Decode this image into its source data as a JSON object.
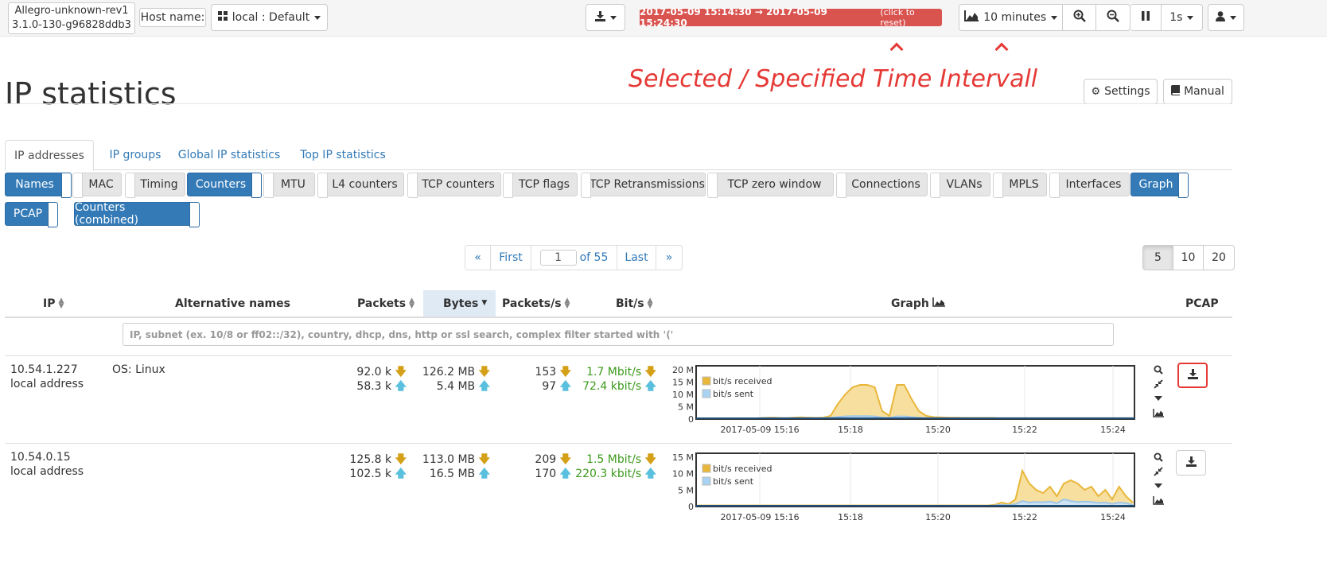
{
  "topbar": {
    "device_line1": "Allegro-unknown-rev1",
    "device_line2": "3.1.0-130-g96828ddb3",
    "host_label": "Host name:",
    "host_value": "local : Default",
    "time_range": "2017-05-09 15:14:30 → 2017-05-09 15:24:30",
    "time_range_hint": "(click to reset)",
    "interval": "10 minutes",
    "refresh_rate": "1s"
  },
  "annotation": "Selected / Specified Time Intervall",
  "page": {
    "title": "IP statistics",
    "settings_label": "Settings",
    "manual_label": "Manual"
  },
  "tabs": [
    "IP addresses",
    "IP groups",
    "Global IP statistics",
    "Top IP statistics"
  ],
  "toggles": [
    {
      "label": "Names",
      "on": true
    },
    {
      "label": "MAC",
      "on": false
    },
    {
      "label": "Timing",
      "on": false
    },
    {
      "label": "Counters",
      "on": true
    },
    {
      "label": "MTU",
      "on": false
    },
    {
      "label": "L4 counters",
      "on": false
    },
    {
      "label": "TCP counters",
      "on": false
    },
    {
      "label": "TCP flags",
      "on": false
    },
    {
      "label": "TCP Retransmissions",
      "on": false
    },
    {
      "label": "TCP zero window",
      "on": false
    },
    {
      "label": "Connections",
      "on": false
    },
    {
      "label": "VLANs",
      "on": false
    },
    {
      "label": "MPLS",
      "on": false
    },
    {
      "label": "Interfaces",
      "on": false
    },
    {
      "label": "Graph",
      "on": true
    },
    {
      "label": "PCAP",
      "on": true
    },
    {
      "label": "Counters (combined)",
      "on": true
    }
  ],
  "pagination": {
    "prev": "«",
    "first": "First",
    "current": "1",
    "of": "of 55",
    "last": "Last",
    "next": "»",
    "sizes": [
      "5",
      "10",
      "20"
    ],
    "selected_size": "5"
  },
  "columns": {
    "ip": "IP",
    "alt": "Alternative names",
    "packets": "Packets",
    "bytes": "Bytes",
    "pps": "Packets/s",
    "bps": "Bit/s",
    "graph": "Graph",
    "pcap": "PCAP"
  },
  "filter_placeholder": "IP, subnet (ex. 10/8 or ff02::/32), country, dhcp, dns, http or ssl search, complex filter started with '('",
  "legend": {
    "received": "bit/s received",
    "sent": "bit/s sent"
  },
  "rows": [
    {
      "ip": "10.54.1.227",
      "sub": "local address",
      "alt": "OS: Linux",
      "packets_in": "92.0 k",
      "packets_out": "58.3 k",
      "bytes_in": "126.2 MB",
      "bytes_out": "5.4 MB",
      "pps_in": "153",
      "pps_out": "97",
      "bps_in": "1.7 Mbit/s",
      "bps_out": "72.4 kbit/s",
      "chart": {
        "y_ticks": [
          "20 M",
          "15 M",
          "10 M",
          "5 M",
          "0"
        ],
        "y_max": 20,
        "x_ticks": [
          "2017-05-09 15:16",
          "15:18",
          "15:20",
          "15:22",
          "15:24"
        ],
        "received": [
          0,
          0,
          0,
          0,
          0,
          0,
          0,
          0,
          0,
          0.2,
          0.3,
          0.2,
          0.1,
          0.3,
          0.4,
          0.3,
          0.2,
          0.3,
          1,
          6,
          10,
          13,
          14,
          14,
          13,
          3,
          1,
          14,
          14,
          8,
          3,
          1,
          0.5,
          0.4,
          0.3,
          0.3,
          0.2,
          0.2,
          0.2,
          0.2,
          0.2,
          0.1,
          0.1,
          0.1,
          0.1,
          0.1,
          0.1,
          0.1,
          0.1,
          0.1,
          0.1,
          0.1,
          0.1,
          0.1,
          0.1,
          0.1,
          0.1,
          0.1,
          0.1,
          0.1
        ],
        "sent": [
          0,
          0,
          0,
          0,
          0,
          0,
          0,
          0,
          0,
          0.1,
          0.1,
          0.1,
          0.1,
          0.1,
          0.1,
          0.1,
          0.1,
          0.1,
          0.2,
          0.6,
          0.8,
          0.9,
          0.9,
          0.9,
          0.8,
          0.3,
          0.2,
          0.8,
          0.8,
          0.5,
          0.2,
          0.1,
          0.1,
          0.1,
          0.1,
          0.1,
          0.1,
          0.1,
          0.1,
          0.1,
          0.1,
          0.1,
          0.1,
          0.1,
          0.1,
          0.1,
          0.1,
          0.1,
          0.1,
          0.1,
          0.1,
          0.1,
          0.1,
          0.1,
          0.1,
          0.1,
          0.1,
          0.1,
          0.1,
          0.1
        ]
      }
    },
    {
      "ip": "10.54.0.15",
      "sub": "local address",
      "alt": "",
      "packets_in": "125.8 k",
      "packets_out": "102.5 k",
      "bytes_in": "113.0 MB",
      "bytes_out": "16.5 MB",
      "pps_in": "209",
      "pps_out": "170",
      "bps_in": "1.5 Mbit/s",
      "bps_out": "220.3 kbit/s",
      "chart": {
        "y_ticks": [
          "15 M",
          "10 M",
          "5 M",
          "0"
        ],
        "y_max": 15,
        "x_ticks": [
          "2017-05-09 15:16",
          "15:18",
          "15:20",
          "15:22",
          "15:24"
        ],
        "received": [
          0.1,
          0.1,
          0.1,
          0.1,
          0.1,
          0.1,
          0.1,
          0.1,
          0.1,
          0.1,
          0.1,
          0.1,
          0.1,
          0.1,
          0.1,
          0.1,
          0.1,
          0.1,
          0.1,
          0.1,
          0.1,
          0.1,
          0.1,
          0.1,
          0.1,
          0.1,
          0.1,
          0.1,
          0.1,
          0.1,
          0.1,
          0.1,
          0.1,
          0.1,
          0.1,
          0.1,
          0.1,
          0.1,
          0.1,
          0.1,
          0.1,
          0.1,
          0.1,
          0.3,
          1,
          0.5,
          2,
          11,
          7,
          5,
          4,
          6,
          3,
          7,
          8,
          7,
          5,
          6,
          3,
          5,
          2,
          6,
          3,
          1
        ],
        "sent": [
          0,
          0,
          0,
          0,
          0,
          0,
          0,
          0,
          0,
          0,
          0,
          0,
          0,
          0,
          0,
          0,
          0,
          0,
          0,
          0,
          0,
          0,
          0,
          0,
          0,
          0,
          0,
          0,
          0,
          0,
          0,
          0,
          0,
          0,
          0,
          0,
          0,
          0,
          0,
          0,
          0,
          0,
          0,
          0.1,
          0.3,
          0.2,
          0.5,
          1.5,
          1,
          1.2,
          1.1,
          1.3,
          0.8,
          2,
          1.5,
          1.2,
          1.3,
          1.2,
          0.9,
          1,
          0.6,
          1,
          0.8,
          0.3
        ]
      }
    }
  ]
}
